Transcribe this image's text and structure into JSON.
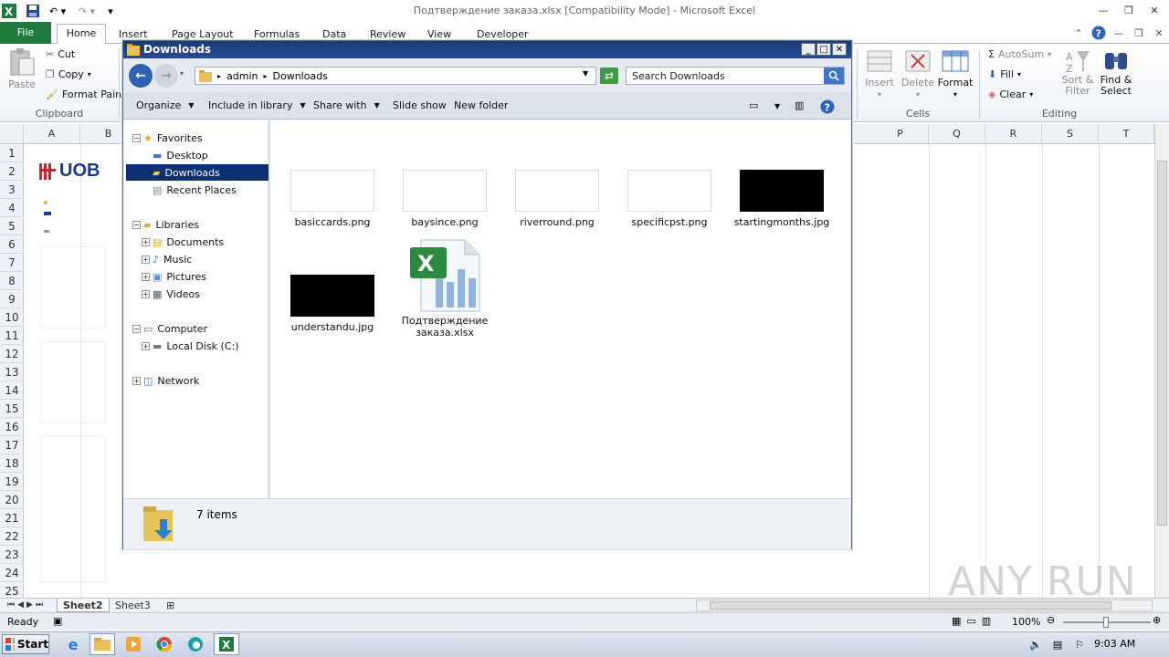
{
  "window": {
    "caption": "Подтверждение заказа.xlsx  [Compatibility Mode]  -  Microsoft Excel"
  },
  "ribbon_tabs": [
    "File",
    "Home",
    "Insert",
    "Page Layout",
    "Formulas",
    "Data",
    "Review",
    "View",
    "Developer"
  ],
  "clipboard": {
    "paste": "Paste",
    "cut": "Cut",
    "copy": "Copy",
    "format_painter": "Format Paint",
    "group_label": "Clipboard"
  },
  "cells_group": {
    "insert": "Insert",
    "delete": "Delete",
    "format": "Format",
    "group_label": "Cells"
  },
  "editing_group": {
    "autosum": "AutoSum",
    "fill": "Fill",
    "clear": "Clear",
    "sort_filter_1": "Sort &",
    "sort_filter_2": "Filter",
    "find_select_1": "Find &",
    "find_select_2": "Select",
    "group_label": "Editing"
  },
  "columns": [
    "A",
    "B",
    "P",
    "Q",
    "R",
    "S",
    "T"
  ],
  "rows": [
    "1",
    "2",
    "3",
    "4",
    "5",
    "6",
    "7",
    "8",
    "9",
    "10",
    "11",
    "12",
    "13",
    "14",
    "15",
    "16",
    "17",
    "18",
    "19",
    "20",
    "21",
    "22",
    "23",
    "24",
    "25"
  ],
  "sheet": {
    "logo_text": "UOB"
  },
  "sheet_tabs": [
    "Sheet2",
    "Sheet3"
  ],
  "status": {
    "ready": "Ready",
    "zoom": "100%"
  },
  "taskbar": {
    "start": "Start",
    "clock": "9:03 AM"
  },
  "explorer": {
    "title": "Downloads",
    "breadcrumb": [
      "admin",
      "Downloads"
    ],
    "search_placeholder": "Search Downloads",
    "commands": [
      "Organize",
      "Include in library",
      "Share with",
      "Slide show",
      "New folder"
    ],
    "nav": {
      "favorites": "Favorites",
      "desktop": "Desktop",
      "downloads": "Downloads",
      "recent": "Recent Places",
      "libraries": "Libraries",
      "documents": "Documents",
      "music": "Music",
      "pictures": "Pictures",
      "videos": "Videos",
      "computer": "Computer",
      "local_disk": "Local Disk (C:)",
      "network": "Network"
    },
    "files": [
      {
        "name": "basiccards.png",
        "thumb": "light"
      },
      {
        "name": "baysince.png",
        "thumb": "light"
      },
      {
        "name": "riverround.png",
        "thumb": "light"
      },
      {
        "name": "specificpst.png",
        "thumb": "light"
      },
      {
        "name": "startingmonths.jpg",
        "thumb": "dark"
      },
      {
        "name": "understandu.jpg",
        "thumb": "dark"
      },
      {
        "name": "Подтверждение заказа.xlsx",
        "thumb": "excel"
      }
    ],
    "item_count": "7 items"
  },
  "watermark": "ANY RUN",
  "colors": {
    "file_tab": "#1f7a3d",
    "title_bar": "#1b3a72",
    "nav_selected": "#0d2f73",
    "uob_red": "#d0222e",
    "uob_blue": "#1b3a8c"
  }
}
